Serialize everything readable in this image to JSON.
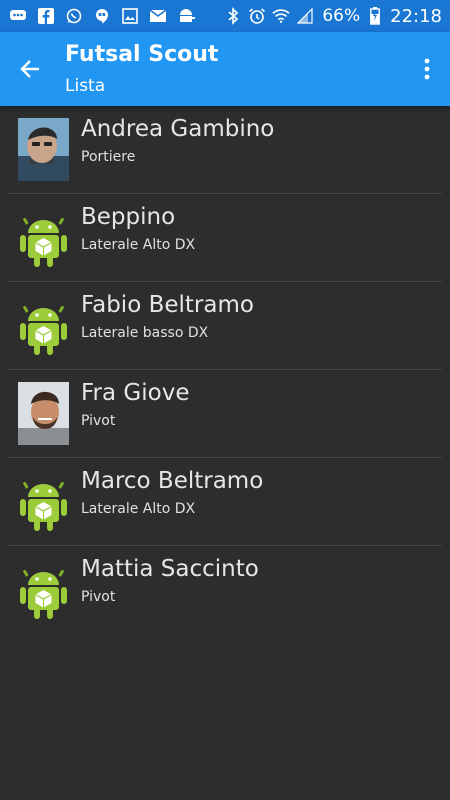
{
  "statusbar": {
    "left_icons": [
      "chat-bubble-icon",
      "facebook-icon",
      "whatsapp-icon",
      "hangouts-icon",
      "gallery-icon",
      "gmail-icon",
      "android-debug-icon"
    ],
    "right_icons": [
      "bluetooth-icon",
      "alarm-icon",
      "wifi-icon",
      "signal-icon",
      "battery-icon"
    ],
    "battery": "66%",
    "time": "22:18",
    "color": "#1976d2"
  },
  "appbar": {
    "title": "Futsal Scout",
    "subtitle": "Lista",
    "color": "#2196f3"
  },
  "players": [
    {
      "name": "Andrea Gambino",
      "role": "Portiere",
      "avatar": "photo"
    },
    {
      "name": "Beppino",
      "role": "Laterale Alto DX",
      "avatar": "android"
    },
    {
      "name": "Fabio Beltramo",
      "role": "Laterale basso DX",
      "avatar": "android"
    },
    {
      "name": "Fra Giove",
      "role": "Pivot",
      "avatar": "photo"
    },
    {
      "name": "Marco Beltramo",
      "role": "Laterale Alto DX",
      "avatar": "android"
    },
    {
      "name": "Mattia Saccinto",
      "role": "Pivot",
      "avatar": "android"
    }
  ]
}
